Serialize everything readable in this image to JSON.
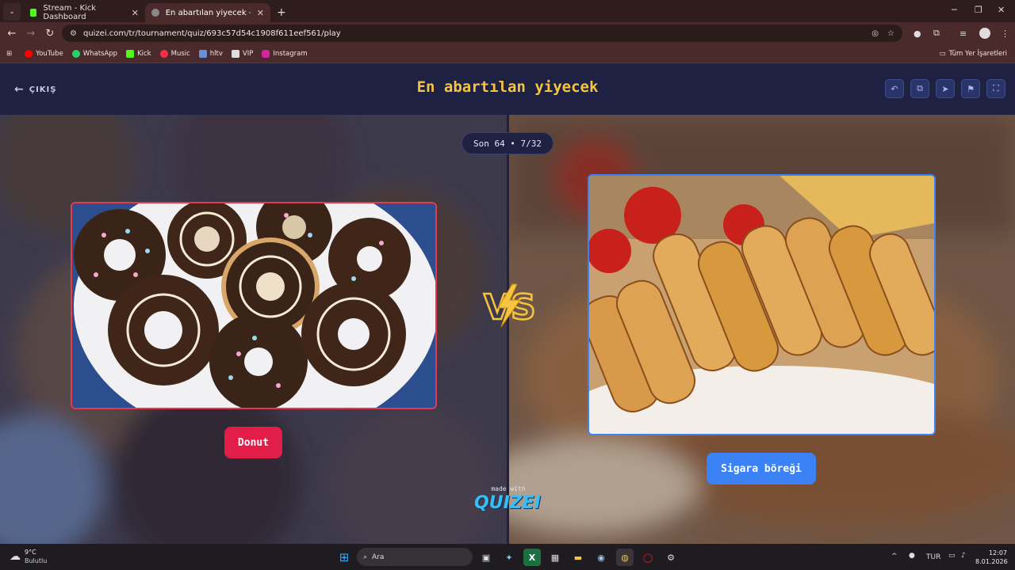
{
  "browser": {
    "tabs": [
      {
        "title": "Stream - Kick Dashboard"
      },
      {
        "title": "En abartılan yiyecek - Tier List, "
      }
    ],
    "url": "quizei.com/tr/tournament/quiz/693c57d54c1908f611eef561/play",
    "bookmarks": [
      {
        "label": "YouTube",
        "color": "#ff0000"
      },
      {
        "label": "WhatsApp",
        "color": "#25d366"
      },
      {
        "label": "Kick",
        "color": "#53fc18"
      },
      {
        "label": "Music",
        "color": "#fa2d48"
      },
      {
        "label": "hltv",
        "color": "#6a8fd8"
      },
      {
        "label": "VIP",
        "color": "#dddddd"
      },
      {
        "label": "Instagram",
        "color": "#d6249f"
      }
    ],
    "all_bookmarks": "Tüm Yer İşaretleri"
  },
  "app": {
    "exit_label": "ÇIKIŞ",
    "title": "En abartılan yiyecek",
    "round": "Son 64 • 7/32",
    "left": {
      "name": "Donut",
      "color": "#e11d48"
    },
    "right": {
      "name": "Sigara böreği",
      "color": "#3b82f6"
    },
    "vs": "VS",
    "made_with": "made with",
    "brand": "QUIZEI",
    "header_icons": [
      "undo-icon",
      "copy-icon",
      "send-icon",
      "flag-icon",
      "fullscreen-icon"
    ]
  },
  "taskbar": {
    "weather_temp": "9°C",
    "weather_desc": "Bulutlu",
    "search_placeholder": "Ara",
    "language": "TUR",
    "time": "12:07",
    "date": "8.01.2026"
  }
}
